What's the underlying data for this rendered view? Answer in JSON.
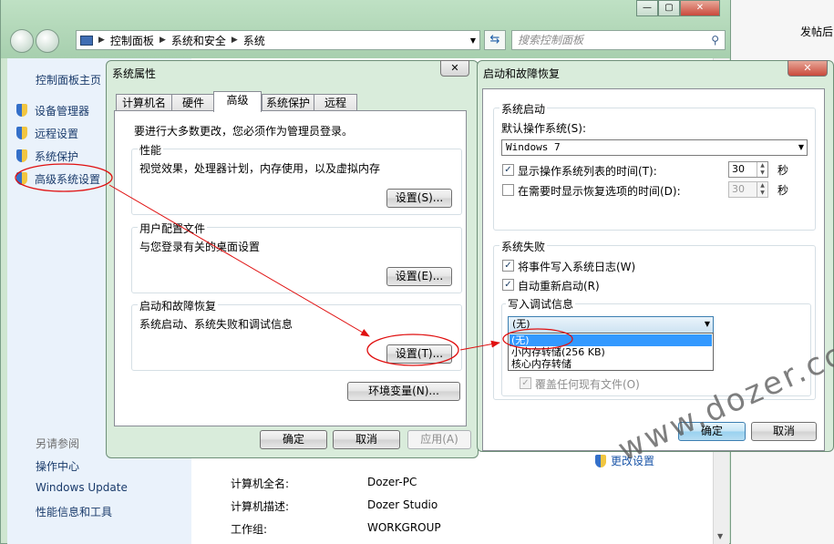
{
  "explorer": {
    "breadcrumbs": [
      "控制面板",
      "系统和安全",
      "系统"
    ],
    "search_placeholder": "搜索控制面板",
    "window_buttons": {
      "minimize": "—",
      "maximize": "▢",
      "close": "✕"
    },
    "sidebar": {
      "home": "控制面板主页",
      "links": [
        "设备管理器",
        "远程设置",
        "系统保护",
        "高级系统设置"
      ],
      "see_also": "另请参阅",
      "bottom_links": [
        "操作中心",
        "Windows Update",
        "性能信息和工具"
      ]
    },
    "main": {
      "rows": [
        {
          "key": "计算机全名:",
          "value": "Dozer-PC"
        },
        {
          "key": "计算机描述:",
          "value": "Dozer Studio"
        },
        {
          "key": "工作组:",
          "value": "WORKGROUP"
        }
      ],
      "change_settings": "更改设置"
    },
    "right_edge_text": "发帖后"
  },
  "system_properties": {
    "title": "系统属性",
    "close": "✕",
    "tabs": [
      "计算机名",
      "硬件",
      "高级",
      "系统保护",
      "远程"
    ],
    "active_tab": "高级",
    "admin_notice": "要进行大多数更改，您必须作为管理员登录。",
    "groups": [
      {
        "label": "性能",
        "desc": "视觉效果，处理器计划，内存使用，以及虚拟内存",
        "button": "设置(S)..."
      },
      {
        "label": "用户配置文件",
        "desc": "与您登录有关的桌面设置",
        "button": "设置(E)..."
      },
      {
        "label": "启动和故障恢复",
        "desc": "系统启动、系统失败和调试信息",
        "button": "设置(T)..."
      }
    ],
    "env_button": "环境变量(N)...",
    "ok": "确定",
    "cancel": "取消",
    "apply": "应用(A)"
  },
  "startup_recovery": {
    "title": "启动和故障恢复",
    "close": "✕",
    "system_startup": {
      "label": "系统启动",
      "default_os_label": "默认操作系统(S):",
      "default_os_value": "Windows 7",
      "show_list_label": "显示操作系统列表的时间(T):",
      "show_list_checked": true,
      "show_list_value": "30",
      "show_recovery_label": "在需要时显示恢复选项的时间(D):",
      "show_recovery_checked": false,
      "show_recovery_value": "30",
      "seconds": "秒"
    },
    "system_failure": {
      "label": "系统失败",
      "write_event_label": "将事件写入系统日志(W)",
      "write_event_checked": true,
      "auto_restart_label": "自动重新启动(R)",
      "auto_restart_checked": true,
      "debug_info_label": "写入调试信息",
      "debug_selected": "(无)",
      "debug_options": [
        "(无)",
        "小内存转储(256 KB)",
        "核心内存转储"
      ],
      "overwrite_label": "覆盖任何现有文件(O)",
      "overwrite_checked": true
    },
    "ok": "确定",
    "cancel": "取消"
  },
  "watermark": "www.dozer.cc",
  "colors": {
    "annotation": "#e01010",
    "accent": "#3c7fb1",
    "link": "#1a3b6b"
  }
}
